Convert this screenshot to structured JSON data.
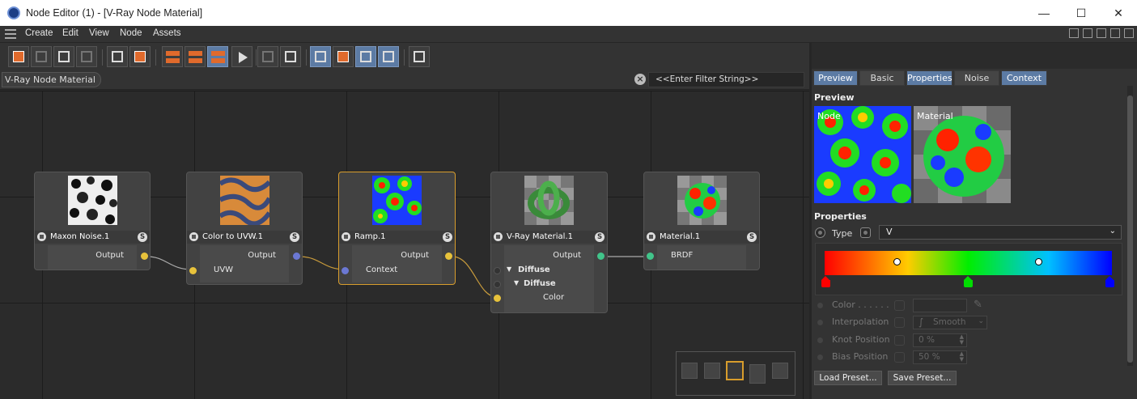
{
  "window": {
    "title": "Node Editor (1) - [V-Ray Node Material]",
    "controls": {
      "minimize": "—",
      "maximize": "☐",
      "close": "✕"
    }
  },
  "menu": {
    "items": [
      "Create",
      "Edit",
      "View",
      "Node",
      "Assets"
    ]
  },
  "breadcrumb": {
    "label": "V-Ray Node Material"
  },
  "filter": {
    "placeholder": "<<Enter Filter String>>"
  },
  "nodes": [
    {
      "title": "Maxon Noise.1",
      "badge": "S",
      "outputs": [
        "Output"
      ],
      "inputs": []
    },
    {
      "title": "Color to UVW.1",
      "badge": "S",
      "outputs": [
        "Output"
      ],
      "inputs": [
        "UVW"
      ]
    },
    {
      "title": "Ramp.1",
      "badge": "S",
      "outputs": [
        "Output"
      ],
      "inputs": [
        "Context"
      ]
    },
    {
      "title": "V-Ray Material.1",
      "badge": "S",
      "outputs": [
        "Output"
      ],
      "groups": [
        "Diffuse",
        "Diffuse"
      ],
      "inputs": [
        "Color"
      ]
    },
    {
      "title": "Material.1",
      "badge": "S",
      "outputs": [],
      "inputs": [
        "BRDF"
      ]
    }
  ],
  "right_panel": {
    "tabs": [
      {
        "label": "Preview",
        "active": true
      },
      {
        "label": "Basic",
        "active": false
      },
      {
        "label": "Properties",
        "active": true
      },
      {
        "label": "Noise",
        "active": false
      },
      {
        "label": "Context",
        "active": true
      }
    ],
    "preview": {
      "heading": "Preview",
      "node_label": "Node",
      "material_label": "Material"
    },
    "properties": {
      "heading": "Properties",
      "type_label": "Type",
      "type_value": "V",
      "gradient": {
        "stops": [
          "#ff0000",
          "#ffcc00",
          "#00ee00",
          "#00c0ff",
          "#0000ff"
        ],
        "markers": [
          "#ff0000",
          "#00dd00",
          "#0000ff"
        ]
      },
      "color_label": "Color . . . . . .",
      "interpolation_label": "Interpolation",
      "interpolation_value": "Smooth",
      "knot_position_label": "Knot Position",
      "knot_position_value": "0 %",
      "bias_position_label": "Bias Position",
      "bias_position_value": "50 %"
    },
    "buttons": {
      "load": "Load Preset...",
      "save": "Save Preset..."
    }
  },
  "colors": {
    "accent": "#5c7ba4",
    "selected_node": "#d89d2c",
    "port_yellow": "#e7c23b",
    "port_blue": "#6b78d4",
    "port_green": "#41c48a"
  }
}
